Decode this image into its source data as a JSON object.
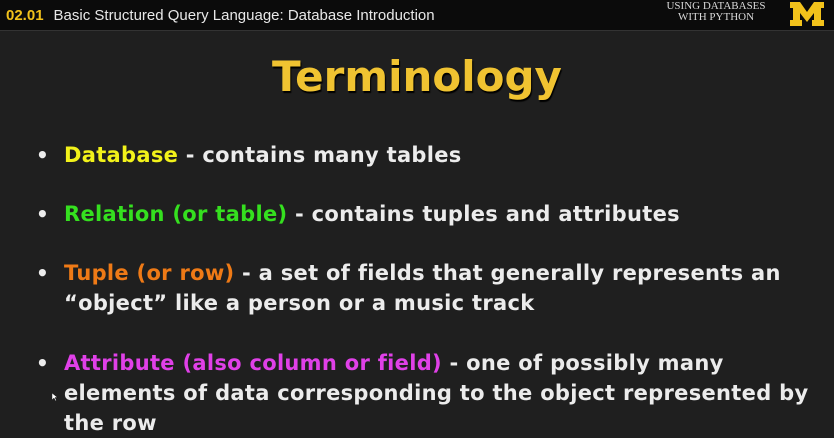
{
  "header": {
    "lesson_number": "02.01",
    "lesson_title": "Basic Structured Query Language: Database Introduction",
    "course_line1": "Using Databases",
    "course_line2": "with Python",
    "logo_letter": "M"
  },
  "slide": {
    "title": "Terminology",
    "bullets": [
      {
        "term": "Database",
        "definition": " - contains many tables"
      },
      {
        "term": "Relation (or table)",
        "definition": " - contains tuples and attributes"
      },
      {
        "term": "Tuple (or row)",
        "definition": " - a set of fields that generally represents an “object” like a person or a music track"
      },
      {
        "term": "Attribute (also column or field)",
        "definition": " - one of possibly many elements of data corresponding to the object represented by the row"
      }
    ]
  },
  "colors": {
    "title": "#f0c331",
    "database": "#f2f21a",
    "relation": "#35e01f",
    "tuple": "#ef7a16",
    "attribute": "#e040e8",
    "michigan_maize": "#f2c21b"
  }
}
